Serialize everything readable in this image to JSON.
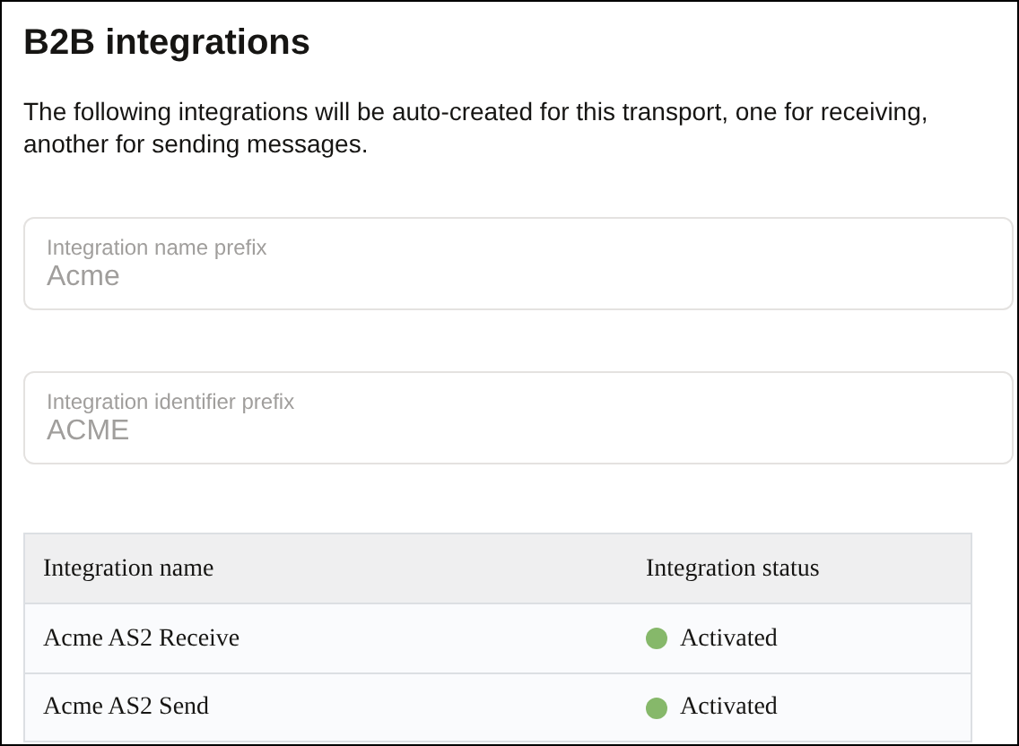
{
  "title": "B2B integrations",
  "description": "The following integrations will be auto-created for this transport, one for receiving, another for sending messages.",
  "fields": [
    {
      "label": "Integration name prefix",
      "value": "Acme",
      "disabled": true
    },
    {
      "label": "Integration identifier prefix",
      "value": "ACME",
      "disabled": true
    }
  ],
  "table": {
    "columns": [
      "Integration name",
      "Integration status"
    ],
    "rows": [
      {
        "name": "Acme AS2 Receive",
        "status": "Activated",
        "color": "#86b86a"
      },
      {
        "name": "Acme AS2 Send",
        "status": "Activated",
        "color": "#86b86a"
      }
    ]
  }
}
